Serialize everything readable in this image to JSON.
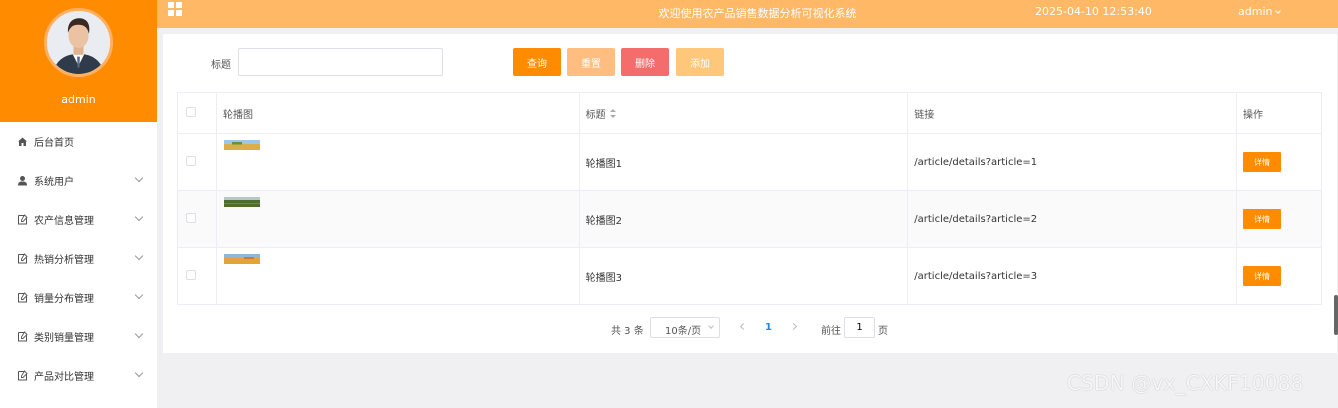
{
  "colors": {
    "brand": "#ff8c00",
    "topbar": "#ffb866",
    "reset_btn": "#ffbe80",
    "delete_btn": "#f56c6c",
    "add_btn": "#ffc77a",
    "page_active": "#1e88e5"
  },
  "header": {
    "title": "欢迎使用农产品销售数据分析可视化系统",
    "datetime": "2025-04-10 12:53:40",
    "user": "admin",
    "menu_icon": "grid-icon"
  },
  "sidebar": {
    "username": "admin",
    "items": [
      {
        "label": "后台首页",
        "icon": "home-icon",
        "has_submenu": false
      },
      {
        "label": "系统用户",
        "icon": "user-icon",
        "has_submenu": true
      },
      {
        "label": "农产信息管理",
        "icon": "document-icon",
        "has_submenu": true
      },
      {
        "label": "热销分析管理",
        "icon": "document-icon",
        "has_submenu": true
      },
      {
        "label": "销量分布管理",
        "icon": "document-icon",
        "has_submenu": true
      },
      {
        "label": "类别销量管理",
        "icon": "document-icon",
        "has_submenu": true
      },
      {
        "label": "产品对比管理",
        "icon": "document-icon",
        "has_submenu": true
      }
    ]
  },
  "search": {
    "label": "标题",
    "value": "",
    "placeholder": ""
  },
  "buttons": {
    "query": "查询",
    "reset": "重置",
    "delete": "删除",
    "add": "添加"
  },
  "table": {
    "columns": [
      "轮播图",
      "标题",
      "链接",
      "操作"
    ],
    "rows": [
      {
        "title": "轮播图1",
        "link": "/article/details?article=1",
        "action": "详情",
        "image": "wheat-field-thumbnail"
      },
      {
        "title": "轮播图2",
        "link": "/article/details?article=2",
        "action": "详情",
        "image": "green-field-thumbnail"
      },
      {
        "title": "轮播图3",
        "link": "/article/details?article=3",
        "action": "详情",
        "image": "golden-field-thumbnail"
      }
    ]
  },
  "pagination": {
    "total": "共 3 条",
    "page_size": "10条/页",
    "current_page": "1",
    "goto_label": "前往",
    "goto_value": "1",
    "page_unit": "页"
  },
  "watermark": "CSDN @vx_CXKF10088"
}
